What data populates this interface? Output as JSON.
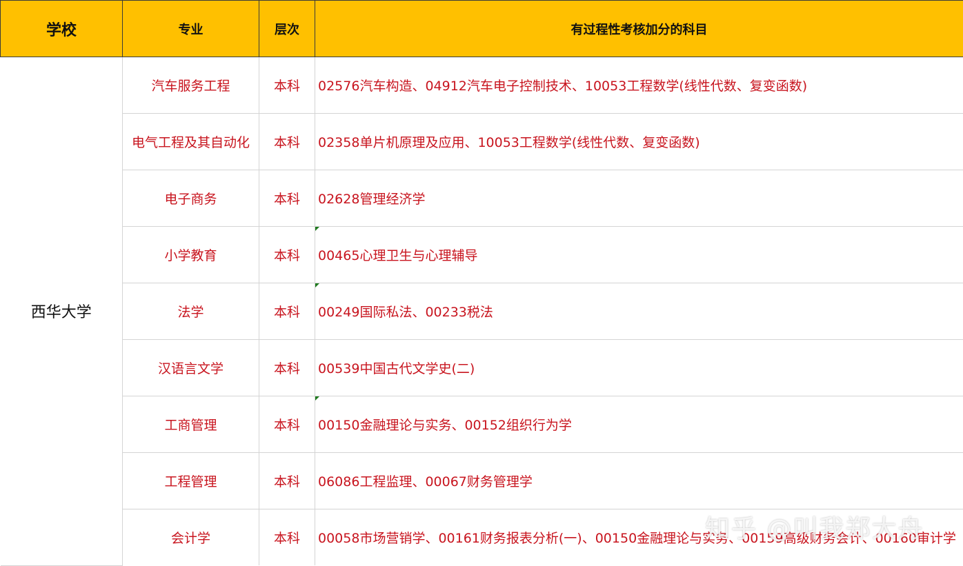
{
  "header": {
    "school": "学校",
    "major": "专业",
    "level": "层次",
    "subjects": "有过程性考核加分的科目"
  },
  "school_name": "西华大学",
  "rows": [
    {
      "major": "汽车服务工程",
      "level": "本科",
      "subjects": "02576汽车构造、04912汽车电子控制技术、10053工程数学(线性代数、复变函数)"
    },
    {
      "major": "电气工程及其自动化",
      "level": "本科",
      "subjects": "02358单片机原理及应用、10053工程数学(线性代数、复变函数)"
    },
    {
      "major": "电子商务",
      "level": "本科",
      "subjects": "02628管理经济学"
    },
    {
      "major": "小学教育",
      "level": "本科",
      "subjects": "00465心理卫生与心理辅导"
    },
    {
      "major": "法学",
      "level": "本科",
      "subjects": "00249国际私法、00233税法"
    },
    {
      "major": "汉语言文学",
      "level": "本科",
      "subjects": "00539中国古代文学史(二)"
    },
    {
      "major": "工商管理",
      "level": "本科",
      "subjects": "00150金融理论与实务、00152组织行为学"
    },
    {
      "major": "工程管理",
      "level": "本科",
      "subjects": "06086工程监理、00067财务管理学"
    },
    {
      "major": "会计学",
      "level": "本科",
      "subjects": "00058市场营销学、00161财务报表分析(一)、00150金融理论与实务、00159高级财务会计、00160审计学"
    }
  ],
  "watermark": "知乎 @叫我郑大舟",
  "colors": {
    "header_bg": "#ffc000",
    "cell_text": "#c8141e",
    "school_text": "#111111",
    "comment_marker": "#1f7a1f"
  }
}
